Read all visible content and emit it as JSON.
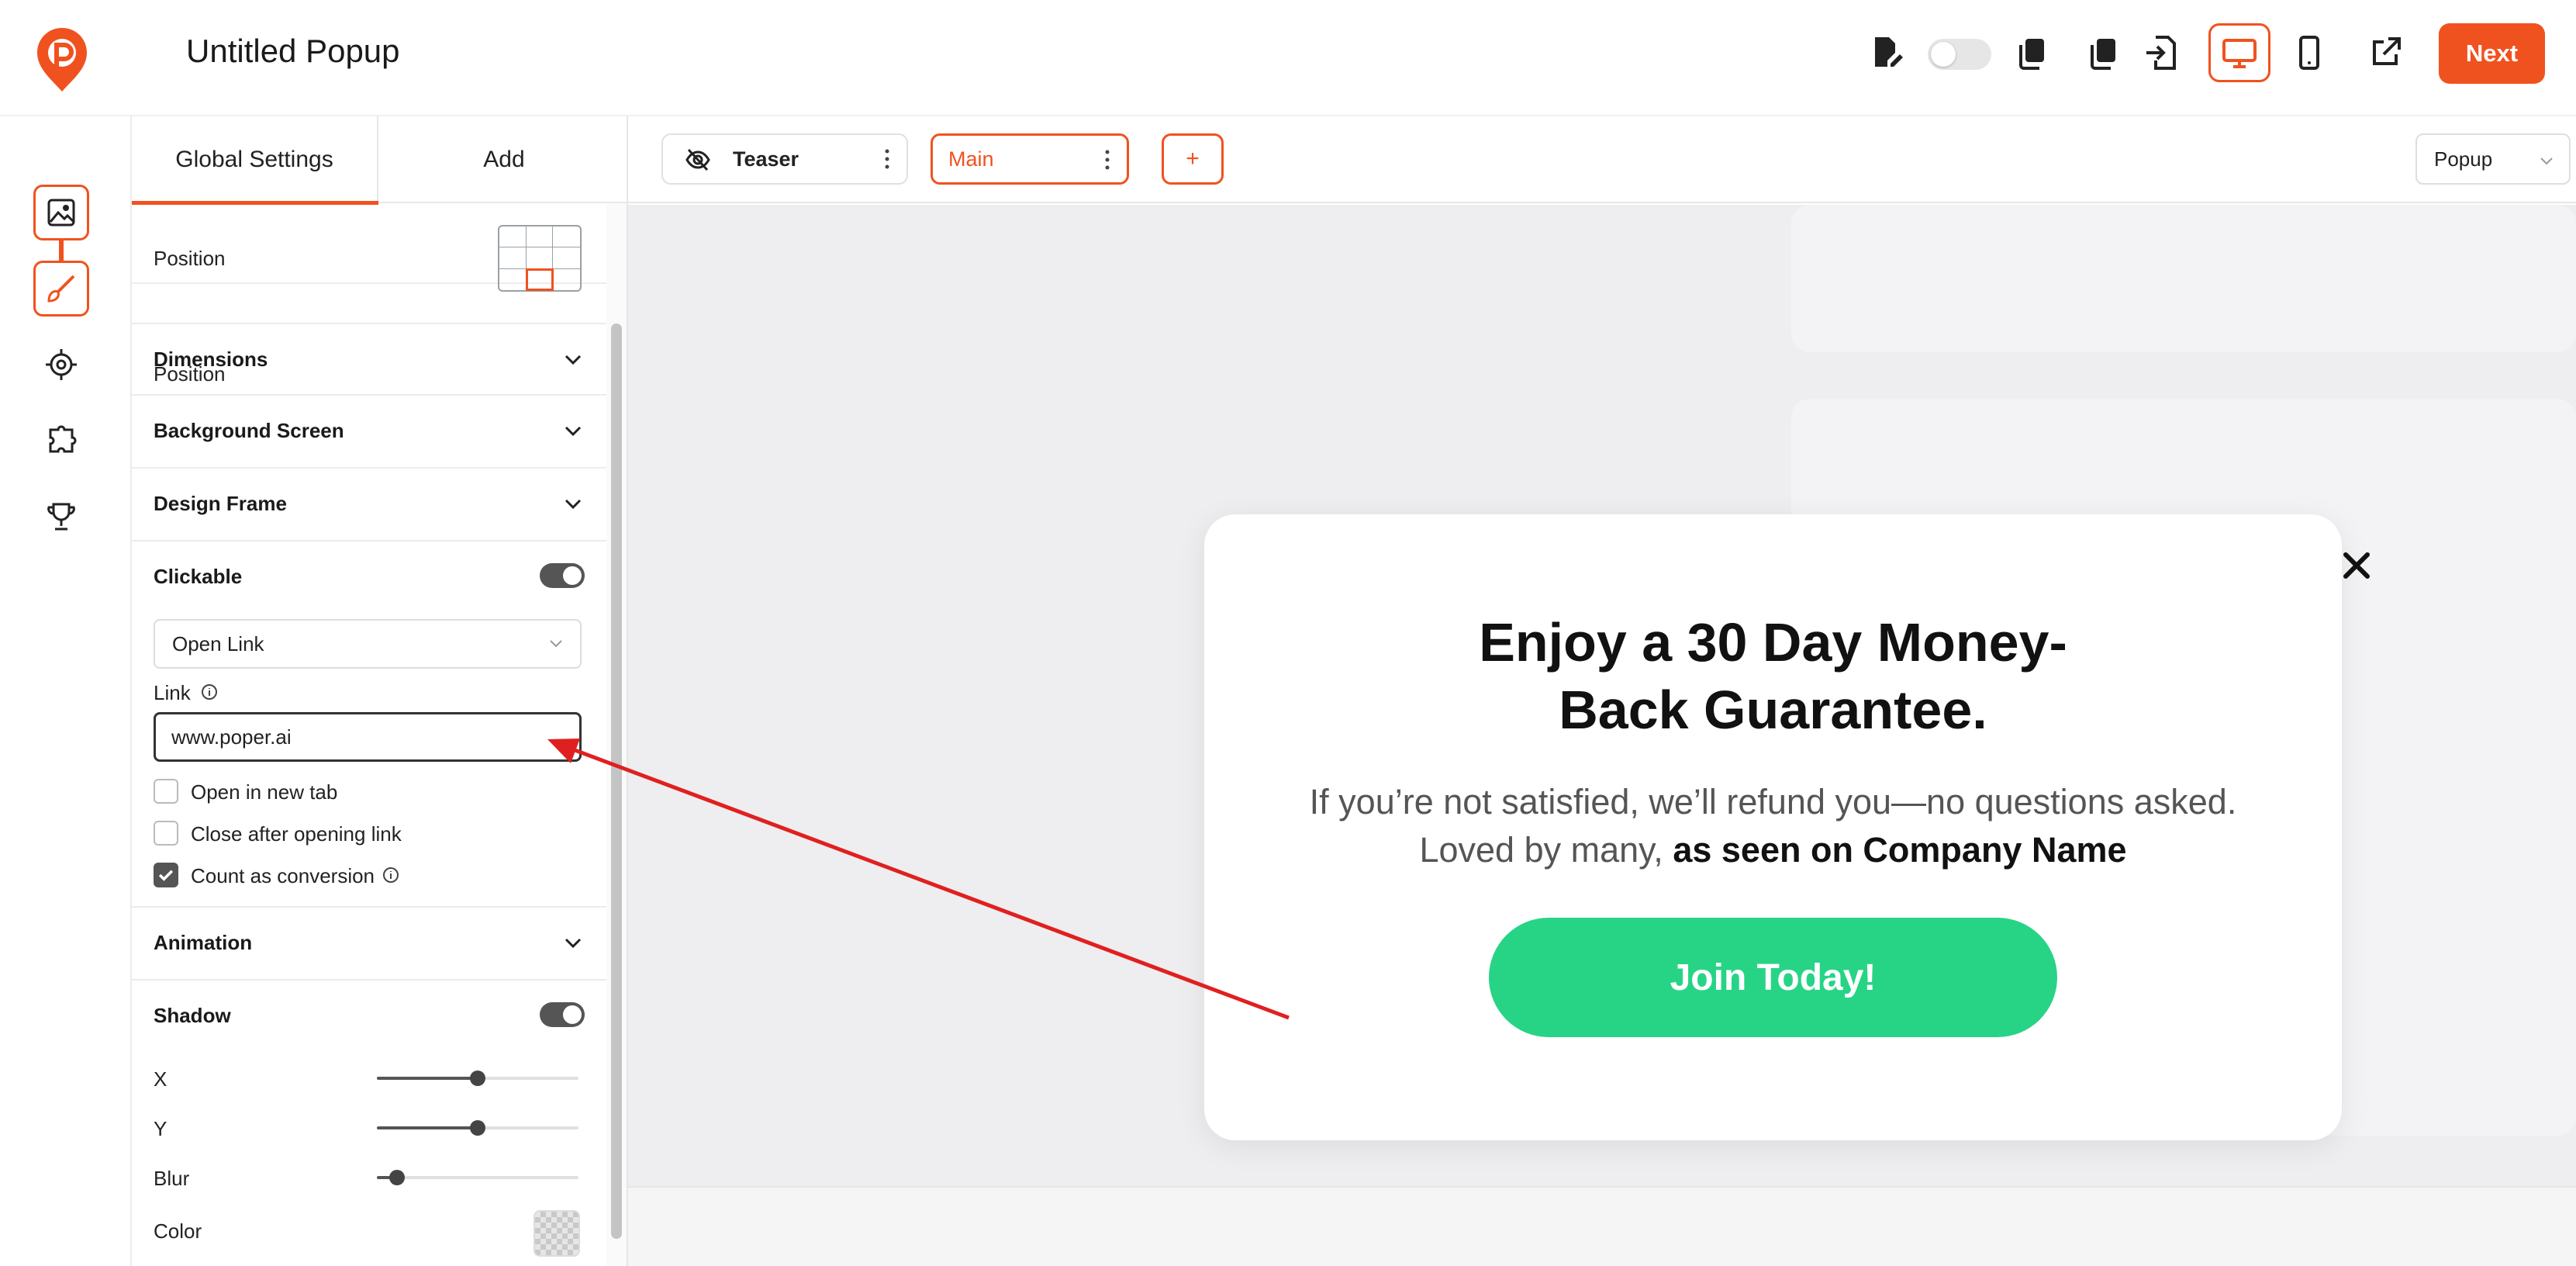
{
  "header": {
    "title": "Untitled Popup",
    "next_label": "Next"
  },
  "panel": {
    "tabs": [
      "Global Settings",
      "Add"
    ],
    "position_label": "Position",
    "sections": {
      "dimensions": "Dimensions",
      "background_screen": "Background Screen",
      "design_frame": "Design Frame",
      "clickable": "Clickable",
      "animation": "Animation",
      "shadow": "Shadow"
    },
    "clickable_enabled": true,
    "shadow_enabled": true,
    "action_select": "Open Link",
    "link_label": "Link",
    "link_value": "www.poper.ai",
    "checkboxes": [
      {
        "label": "Open in new tab",
        "checked": false
      },
      {
        "label": "Close after opening link",
        "checked": false
      },
      {
        "label": "Count as conversion",
        "checked": true
      }
    ],
    "shadow_controls": {
      "x_label": "X",
      "y_label": "Y",
      "blur_label": "Blur",
      "color_label": "Color",
      "x_value": 0.5,
      "y_value": 0.5,
      "blur_value": 0.1
    }
  },
  "steps": {
    "teaser": "Teaser",
    "main": "Main",
    "add": "+"
  },
  "view_select": "Popup",
  "popup": {
    "title_line1": "Enjoy a 30 Day Money-",
    "title_line2": "Back Guarantee.",
    "body_plain": "If you’re not satisfied, we’ll refund you—no questions asked. Loved by many,",
    "body_bold": "as seen on Company Name",
    "cta": "Join Today!",
    "cta_color": "#27d486"
  },
  "colors": {
    "accent": "#f0521f",
    "annotation_arrow": "#e02020"
  }
}
